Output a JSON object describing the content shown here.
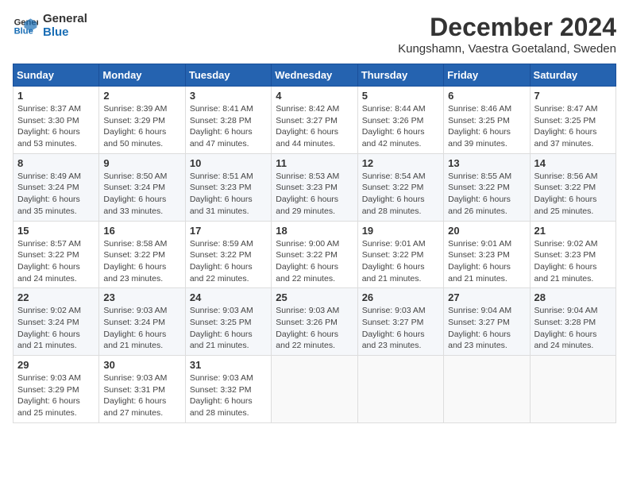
{
  "logo": {
    "line1": "General",
    "line2": "Blue"
  },
  "title": {
    "month": "December 2024",
    "location": "Kungshamn, Vaestra Goetaland, Sweden"
  },
  "calendar": {
    "headers": [
      "Sunday",
      "Monday",
      "Tuesday",
      "Wednesday",
      "Thursday",
      "Friday",
      "Saturday"
    ],
    "rows": [
      [
        {
          "day": "1",
          "info": "Sunrise: 8:37 AM\nSunset: 3:30 PM\nDaylight: 6 hours\nand 53 minutes."
        },
        {
          "day": "2",
          "info": "Sunrise: 8:39 AM\nSunset: 3:29 PM\nDaylight: 6 hours\nand 50 minutes."
        },
        {
          "day": "3",
          "info": "Sunrise: 8:41 AM\nSunset: 3:28 PM\nDaylight: 6 hours\nand 47 minutes."
        },
        {
          "day": "4",
          "info": "Sunrise: 8:42 AM\nSunset: 3:27 PM\nDaylight: 6 hours\nand 44 minutes."
        },
        {
          "day": "5",
          "info": "Sunrise: 8:44 AM\nSunset: 3:26 PM\nDaylight: 6 hours\nand 42 minutes."
        },
        {
          "day": "6",
          "info": "Sunrise: 8:46 AM\nSunset: 3:25 PM\nDaylight: 6 hours\nand 39 minutes."
        },
        {
          "day": "7",
          "info": "Sunrise: 8:47 AM\nSunset: 3:25 PM\nDaylight: 6 hours\nand 37 minutes."
        }
      ],
      [
        {
          "day": "8",
          "info": "Sunrise: 8:49 AM\nSunset: 3:24 PM\nDaylight: 6 hours\nand 35 minutes."
        },
        {
          "day": "9",
          "info": "Sunrise: 8:50 AM\nSunset: 3:24 PM\nDaylight: 6 hours\nand 33 minutes."
        },
        {
          "day": "10",
          "info": "Sunrise: 8:51 AM\nSunset: 3:23 PM\nDaylight: 6 hours\nand 31 minutes."
        },
        {
          "day": "11",
          "info": "Sunrise: 8:53 AM\nSunset: 3:23 PM\nDaylight: 6 hours\nand 29 minutes."
        },
        {
          "day": "12",
          "info": "Sunrise: 8:54 AM\nSunset: 3:22 PM\nDaylight: 6 hours\nand 28 minutes."
        },
        {
          "day": "13",
          "info": "Sunrise: 8:55 AM\nSunset: 3:22 PM\nDaylight: 6 hours\nand 26 minutes."
        },
        {
          "day": "14",
          "info": "Sunrise: 8:56 AM\nSunset: 3:22 PM\nDaylight: 6 hours\nand 25 minutes."
        }
      ],
      [
        {
          "day": "15",
          "info": "Sunrise: 8:57 AM\nSunset: 3:22 PM\nDaylight: 6 hours\nand 24 minutes."
        },
        {
          "day": "16",
          "info": "Sunrise: 8:58 AM\nSunset: 3:22 PM\nDaylight: 6 hours\nand 23 minutes."
        },
        {
          "day": "17",
          "info": "Sunrise: 8:59 AM\nSunset: 3:22 PM\nDaylight: 6 hours\nand 22 minutes."
        },
        {
          "day": "18",
          "info": "Sunrise: 9:00 AM\nSunset: 3:22 PM\nDaylight: 6 hours\nand 22 minutes."
        },
        {
          "day": "19",
          "info": "Sunrise: 9:01 AM\nSunset: 3:22 PM\nDaylight: 6 hours\nand 21 minutes."
        },
        {
          "day": "20",
          "info": "Sunrise: 9:01 AM\nSunset: 3:23 PM\nDaylight: 6 hours\nand 21 minutes."
        },
        {
          "day": "21",
          "info": "Sunrise: 9:02 AM\nSunset: 3:23 PM\nDaylight: 6 hours\nand 21 minutes."
        }
      ],
      [
        {
          "day": "22",
          "info": "Sunrise: 9:02 AM\nSunset: 3:24 PM\nDaylight: 6 hours\nand 21 minutes."
        },
        {
          "day": "23",
          "info": "Sunrise: 9:03 AM\nSunset: 3:24 PM\nDaylight: 6 hours\nand 21 minutes."
        },
        {
          "day": "24",
          "info": "Sunrise: 9:03 AM\nSunset: 3:25 PM\nDaylight: 6 hours\nand 21 minutes."
        },
        {
          "day": "25",
          "info": "Sunrise: 9:03 AM\nSunset: 3:26 PM\nDaylight: 6 hours\nand 22 minutes."
        },
        {
          "day": "26",
          "info": "Sunrise: 9:03 AM\nSunset: 3:27 PM\nDaylight: 6 hours\nand 23 minutes."
        },
        {
          "day": "27",
          "info": "Sunrise: 9:04 AM\nSunset: 3:27 PM\nDaylight: 6 hours\nand 23 minutes."
        },
        {
          "day": "28",
          "info": "Sunrise: 9:04 AM\nSunset: 3:28 PM\nDaylight: 6 hours\nand 24 minutes."
        }
      ],
      [
        {
          "day": "29",
          "info": "Sunrise: 9:03 AM\nSunset: 3:29 PM\nDaylight: 6 hours\nand 25 minutes."
        },
        {
          "day": "30",
          "info": "Sunrise: 9:03 AM\nSunset: 3:31 PM\nDaylight: 6 hours\nand 27 minutes."
        },
        {
          "day": "31",
          "info": "Sunrise: 9:03 AM\nSunset: 3:32 PM\nDaylight: 6 hours\nand 28 minutes."
        },
        {
          "day": "",
          "info": ""
        },
        {
          "day": "",
          "info": ""
        },
        {
          "day": "",
          "info": ""
        },
        {
          "day": "",
          "info": ""
        }
      ]
    ]
  }
}
